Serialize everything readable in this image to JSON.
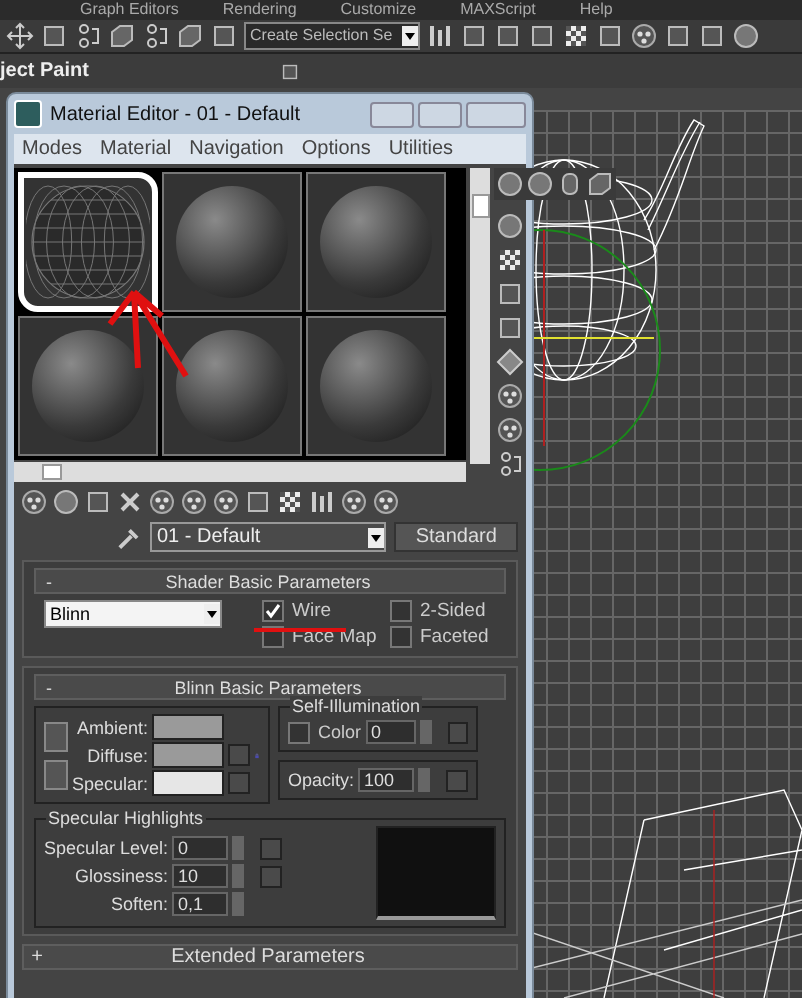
{
  "menu_bar": [
    "Graph Editors",
    "Rendering",
    "Customize",
    "MAXScript",
    "Help"
  ],
  "toolbar": {
    "selection_set": "Create Selection Se"
  },
  "ribbon": {
    "label": "ject Paint"
  },
  "material_editor": {
    "title": "Material Editor - 01 - Default",
    "menus": [
      "Modes",
      "Material",
      "Navigation",
      "Options",
      "Utilities"
    ],
    "slots": [
      {
        "kind": "wire",
        "selected": true
      },
      {
        "kind": "solid",
        "selected": false
      },
      {
        "kind": "solid",
        "selected": false
      },
      {
        "kind": "solid",
        "selected": false
      },
      {
        "kind": "solid",
        "selected": false
      },
      {
        "kind": "solid",
        "selected": false
      }
    ],
    "material_name": "01 - Default",
    "material_type": "Standard",
    "shader_rollout": {
      "title": "Shader Basic Parameters",
      "toggle": "-",
      "shader": "Blinn",
      "options": [
        {
          "label": "Wire",
          "checked": true
        },
        {
          "label": "2-Sided",
          "checked": false
        },
        {
          "label": "Face Map",
          "checked": false
        },
        {
          "label": "Faceted",
          "checked": false
        }
      ]
    },
    "blinn_rollout": {
      "title": "Blinn Basic Parameters",
      "toggle": "-",
      "colors": [
        {
          "label": "Ambient:",
          "color": "#9a9a9a"
        },
        {
          "label": "Diffuse:",
          "color": "#9a9a9a"
        },
        {
          "label": "Specular:",
          "color": "#e6e6e6"
        }
      ],
      "self_illumination": {
        "title": "Self-Illumination",
        "label": "Color",
        "checked": false,
        "value": "0"
      },
      "opacity": {
        "label": "Opacity:",
        "value": "100"
      },
      "specular_highlights": {
        "title": "Specular Highlights",
        "fields": [
          {
            "label": "Specular Level:",
            "value": "0"
          },
          {
            "label": "Glossiness:",
            "value": "10"
          },
          {
            "label": "Soften:",
            "value": "0,1"
          }
        ]
      }
    },
    "extended_rollout": {
      "title": "Extended Parameters",
      "toggle": "+"
    }
  }
}
